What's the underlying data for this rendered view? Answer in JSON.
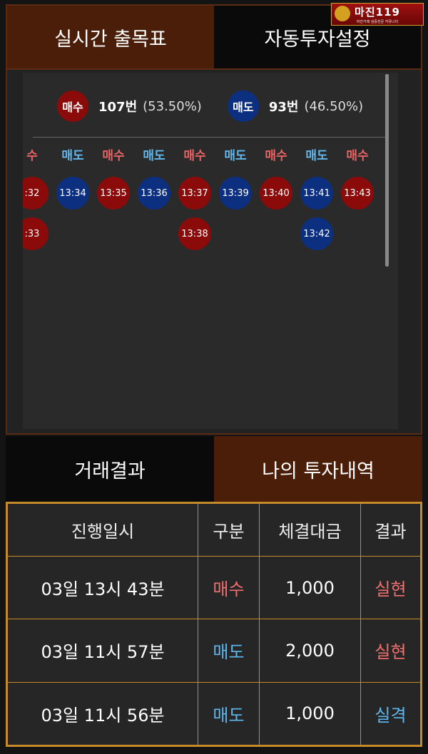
{
  "top_tabs": {
    "live": "실시간 출목표",
    "auto": "자동투자설정"
  },
  "logo": {
    "main": "마진119",
    "sub": "마진거래 검증전문 커뮤니티"
  },
  "stats": {
    "buy_label": "매수",
    "buy_count": "107번",
    "buy_pct": "(53.50%)",
    "sell_label": "매도",
    "sell_count": "93번",
    "sell_pct": "(46.50%)"
  },
  "columns": [
    {
      "head": "수",
      "side": "buy",
      "times": [
        ":32",
        ":33"
      ]
    },
    {
      "head": "매도",
      "side": "sell",
      "times": [
        "13:34"
      ]
    },
    {
      "head": "매수",
      "side": "buy",
      "times": [
        "13:35"
      ]
    },
    {
      "head": "매도",
      "side": "sell",
      "times": [
        "13:36"
      ]
    },
    {
      "head": "매수",
      "side": "buy",
      "times": [
        "13:37",
        "13:38"
      ]
    },
    {
      "head": "매도",
      "side": "sell",
      "times": [
        "13:39"
      ]
    },
    {
      "head": "매수",
      "side": "buy",
      "times": [
        "13:40"
      ]
    },
    {
      "head": "매도",
      "side": "sell",
      "times": [
        "13:41",
        "13:42"
      ]
    },
    {
      "head": "매수",
      "side": "buy",
      "times": [
        "13:43"
      ]
    }
  ],
  "bottom_tabs": {
    "results": "거래결과",
    "history": "나의 투자내역"
  },
  "table": {
    "headers": [
      "진행일시",
      "구분",
      "체결대금",
      "결과"
    ],
    "rows": [
      {
        "date": "03일 13시 43분",
        "type": "매수",
        "amount": "1,000",
        "result": "실현",
        "type_color": "buy",
        "result_color": "buy"
      },
      {
        "date": "03일 11시 57분",
        "type": "매도",
        "amount": "2,000",
        "result": "실현",
        "type_color": "sell",
        "result_color": "buy"
      },
      {
        "date": "03일 11시 56분",
        "type": "매도",
        "amount": "1,000",
        "result": "실격",
        "type_color": "sell",
        "result_color": "sell"
      }
    ]
  }
}
